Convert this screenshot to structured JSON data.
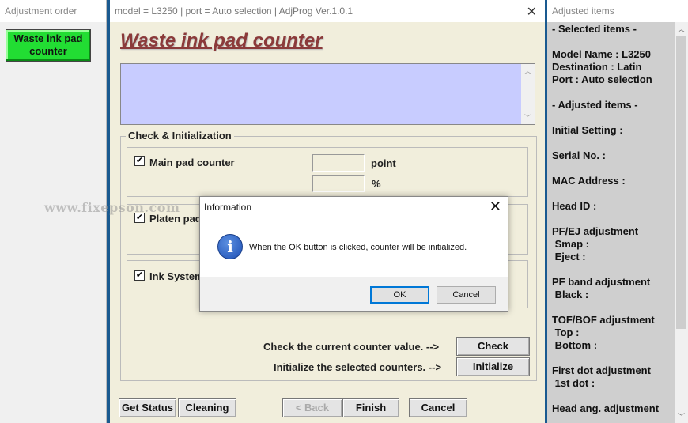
{
  "left_window": {
    "title": "Adjustment order",
    "waste_button_label": "Waste ink pad counter"
  },
  "main_window": {
    "title": "model = L3250 | port = Auto selection | AdjProg Ver.1.0.1",
    "heading": "Waste ink pad counter",
    "group_title": "Check & Initialization",
    "main_pad": {
      "label": "Main pad counter",
      "checked": true,
      "unit_point": "point",
      "unit_percent": "%"
    },
    "platen_pad": {
      "label": "Platen pad",
      "checked": true
    },
    "ink_system": {
      "label": "Ink System",
      "checked": true
    },
    "check_prompt": "Check the current counter value.  -->",
    "check_button": "Check",
    "init_prompt": "Initialize the selected counters.  -->",
    "init_button": "Initialize",
    "footer": {
      "get_status": "Get Status",
      "cleaning": "Cleaning",
      "back": "< Back",
      "finish": "Finish",
      "cancel": "Cancel"
    },
    "watermark": "www.fixepson.com"
  },
  "dialog": {
    "title": "Information",
    "message": "When the OK button is clicked, counter will be initialized.",
    "ok": "OK",
    "cancel": "Cancel"
  },
  "right_window": {
    "title": "Adjusted items",
    "items": [
      "- Selected items -",
      "Model Name : L3250",
      "Destination : Latin",
      "Port : Auto selection",
      "- Adjusted items -",
      "Initial Setting :",
      "Serial No. :",
      "MAC Address :",
      "Head ID :",
      "PF/EJ adjustment",
      " Smap :",
      " Eject :",
      "PF band adjustment",
      " Black :",
      "TOF/BOF adjustment",
      " Top :",
      " Bottom :",
      "First dot adjustment",
      " 1st dot :",
      "Head ang. adjustment"
    ]
  }
}
